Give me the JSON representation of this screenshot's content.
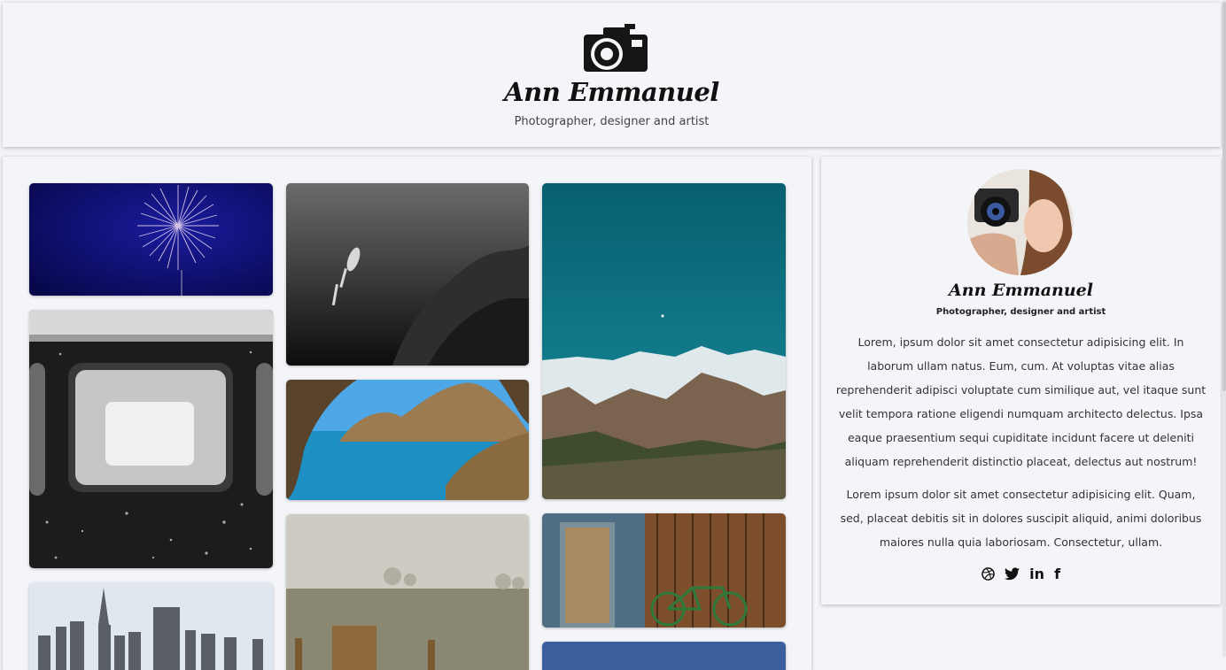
{
  "header": {
    "logo_icon": "camera-icon",
    "title": "Ann Emmanuel",
    "subtitle": "Photographer, designer and artist"
  },
  "gallery": {
    "photos": [
      {
        "name": "fireworks-photo",
        "colors": [
          "#0a0a5c",
          "#1a1a9a"
        ]
      },
      {
        "name": "train-window-photo",
        "colors": [
          "#1a1a1a",
          "#cfcfcf"
        ]
      },
      {
        "name": "city-skyline-photo",
        "colors": [
          "#dfe6ee",
          "#555"
        ]
      },
      {
        "name": "diver-photo",
        "colors": [
          "#111",
          "#666"
        ]
      },
      {
        "name": "coast-cliff-photo",
        "colors": [
          "#1e8fc2",
          "#8b6a3e"
        ]
      },
      {
        "name": "foggy-field-photo",
        "colors": [
          "#cfcdc3",
          "#6e6a55"
        ]
      },
      {
        "name": "mountain-lake-photo",
        "colors": [
          "#0b6c7c",
          "#6b5946"
        ]
      },
      {
        "name": "wooden-door-bike-photo",
        "colors": [
          "#7a5030",
          "#3e2a18"
        ]
      },
      {
        "name": "blue-sky-photo",
        "colors": [
          "#3a5f9a",
          "#6c89b8"
        ]
      }
    ]
  },
  "profile": {
    "avatar_icon": "profile-photo",
    "name": "Ann Emmanuel",
    "subtitle": "Photographer, designer and artist",
    "bio_1": "Lorem, ipsum dolor sit amet consectetur adipisicing elit. In laborum ullam natus. Eum, cum. At voluptas vitae alias reprehenderit adipisci voluptate cum similique aut, vel itaque sunt velit tempora ratione eligendi numquam architecto delectus. Ipsa eaque praesentium sequi cupiditate incidunt facere ut deleniti aliquam reprehenderit distinctio placeat, delectus aut nostrum!",
    "bio_2": "Lorem ipsum dolor sit amet consectetur adipisicing elit. Quam, sed, placeat debitis sit in dolores suscipit aliquid, animi doloribus maiores nulla quia laboriosam. Consectetur, ullam.",
    "social": {
      "dribbble": "dribbble-icon",
      "twitter": "twitter-icon",
      "linkedin": "in",
      "facebook": "f"
    }
  }
}
